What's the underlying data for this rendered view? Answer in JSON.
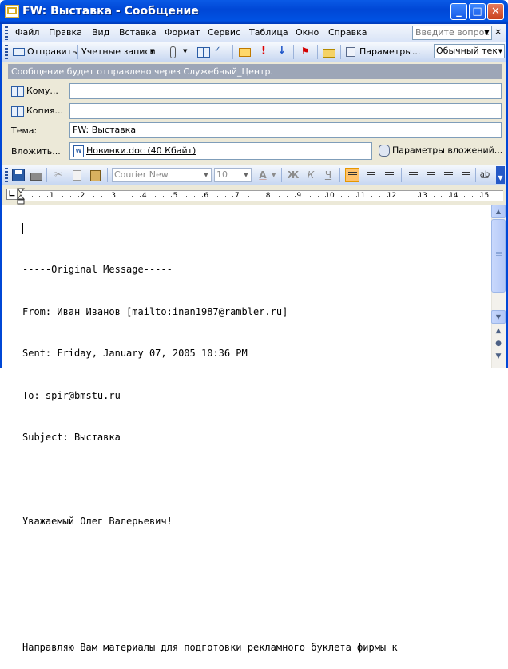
{
  "window": {
    "title": "FW: Выставка - Сообщение",
    "min_glyph": "_",
    "max_glyph": "□",
    "close_glyph": "✕"
  },
  "menu": {
    "items": [
      "Файл",
      "Правка",
      "Вид",
      "Вставка",
      "Формат",
      "Сервис",
      "Таблица",
      "Окно",
      "Справка"
    ],
    "help_placeholder": "Введите вопрос",
    "close_glyph": "×"
  },
  "toolbar": {
    "send_label": "Отправить",
    "accounts_label": "Учетные записи",
    "options_label": "Параметры...",
    "format_value": "Обычный текст"
  },
  "infobar": {
    "text": "Сообщение будет отправлено через Служебный_Центр."
  },
  "fields": {
    "to_label": "Кому...",
    "to_value": "",
    "cc_label": "Копия...",
    "cc_value": "",
    "subject_label": "Тема:",
    "subject_value": "FW: Выставка",
    "attach_label": "Вложить...",
    "attachment_name": "Новинки.doc (40 Кбайт)",
    "attach_options_label": "Параметры вложений..."
  },
  "format_toolbar": {
    "font_name": "Courier New",
    "font_size": "10",
    "bold": "Ж",
    "italic": "К",
    "underline": "Ч",
    "font_color_glyph": "A"
  },
  "ruler": {
    "labels": [
      "1",
      "2",
      "3",
      "4",
      "5",
      "6",
      "7",
      "8",
      "9",
      "10",
      "11",
      "12",
      "13",
      "14",
      "15"
    ]
  },
  "body": {
    "lines": [
      "-----Original Message-----",
      "From: Иван Иванов [mailto:inan1987@rambler.ru]",
      "Sent: Friday, January 07, 2005 10:36 PM",
      "To: spir@bmstu.ru",
      "Subject: Выставка",
      "",
      "Уважаемый Олег Валерьевич!",
      "",
      "",
      "Направляю Вам материалы для подготовки рекламного буклета фирмы к"
    ]
  },
  "colors": {
    "titlebar": "#0047d6",
    "infobar": "#9da6b7",
    "active_align": "#ffc26b"
  }
}
